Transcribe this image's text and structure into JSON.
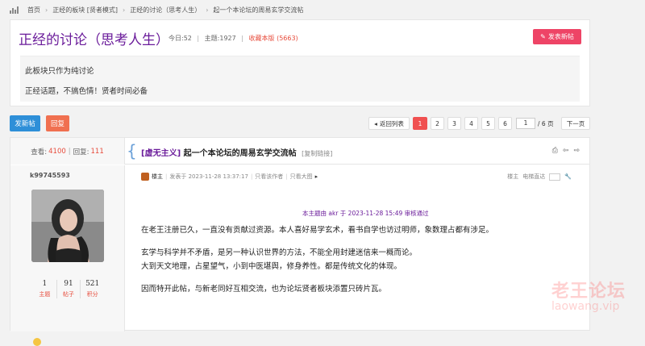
{
  "breadcrumb": {
    "items": [
      "首页",
      "正经的板块 [贤者模式]",
      "正经的讨论（思考人生）",
      "起一个本论坛的周易玄学交流帖"
    ],
    "sep": "›"
  },
  "forum": {
    "title": "正经的讨论（思考人生）",
    "today": "今日:52",
    "topics": "主题:1927",
    "favorite": "收藏本版 (5663)",
    "post_button": "发表新帖",
    "desc_line1": "此板块只作为纯讨论",
    "desc_line2": "正经话题，不搞色情！贤者时间必备"
  },
  "actions": {
    "new_post": "发新帖",
    "reply": "回复"
  },
  "pagination": {
    "back": "返回列表",
    "pages": [
      "1",
      "2",
      "3",
      "4",
      "5",
      "6"
    ],
    "current": "1",
    "total": "/ 6 页",
    "next": "下一页"
  },
  "thread": {
    "views_label": "查看:",
    "views": "4100",
    "replies_label": "回复:",
    "replies": "111",
    "tag": "[虚无主义]",
    "title": "起一个本论坛的周易玄学交流帖",
    "copy_link": "[复制链接]"
  },
  "author": {
    "name": "k99745593",
    "stats": [
      {
        "num": "1",
        "label": "主题"
      },
      {
        "num": "91",
        "label": "帖子"
      },
      {
        "num": "521",
        "label": "积分"
      }
    ]
  },
  "post": {
    "owner_tag": "楼主",
    "posted": "发表于 2023-11-28 13:37:17",
    "only_author": "只看该作者",
    "large_img": "只看大图",
    "floor": "楼主",
    "direct": "电梯直达",
    "edit_note": "本主题由 akr 于 2023-11-28 15:49 审核通过",
    "p1": "在老王注册已久，一直没有贡献过资源。本人喜好易学玄术，看书自学也访过明师，象数理占都有涉足。",
    "p2": "玄学与科学并不矛盾，是另一种认识世界的方法，不能全用封建迷信来一概而论。",
    "p3": "大到天文地理，占星望气，小到中医堪舆，修身养性。都是传统文化的体现。",
    "p4": "因而特开此帖，与新老同好互相交流，也为论坛贤者板块添置只砖片瓦。"
  },
  "watermark": {
    "cn": "老王论坛",
    "en": "laowang.vip"
  }
}
